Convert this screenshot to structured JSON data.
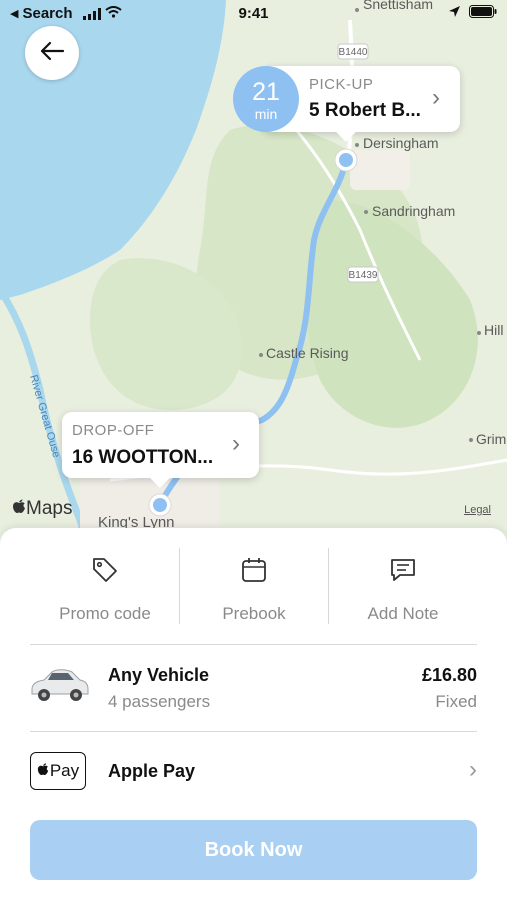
{
  "status_bar": {
    "back_app": "Search",
    "time": "9:41"
  },
  "map": {
    "places": [
      "Snettisham",
      "Dersingham",
      "Sandringham",
      "Castle Rising",
      "Hill",
      "Grim",
      "King's Lynn"
    ],
    "roads": [
      "B1440",
      "B1439"
    ],
    "river": "River Great Ouse",
    "attribution": "Maps",
    "legal": "Legal"
  },
  "eta": {
    "value": "21",
    "unit": "min"
  },
  "pickup": {
    "caption": "PICK-UP",
    "address": "5 Robert B..."
  },
  "dropoff": {
    "caption": "DROP-OFF",
    "address": "16 WOOTTON..."
  },
  "actions": [
    {
      "label": "Promo code",
      "icon": "tag-icon"
    },
    {
      "label": "Prebook",
      "icon": "calendar-icon"
    },
    {
      "label": "Add Note",
      "icon": "note-icon"
    }
  ],
  "vehicle": {
    "name": "Any Vehicle",
    "passengers": "4 passengers",
    "price": "£16.80",
    "fare_type": "Fixed"
  },
  "payment": {
    "badge": "Pay",
    "method": "Apple Pay"
  },
  "book_button": "Book Now",
  "colors": {
    "accent": "#a9cff3",
    "eta_bubble": "#8ec1f2",
    "route": "#8ec1f2",
    "water": "#a9d7ee"
  }
}
